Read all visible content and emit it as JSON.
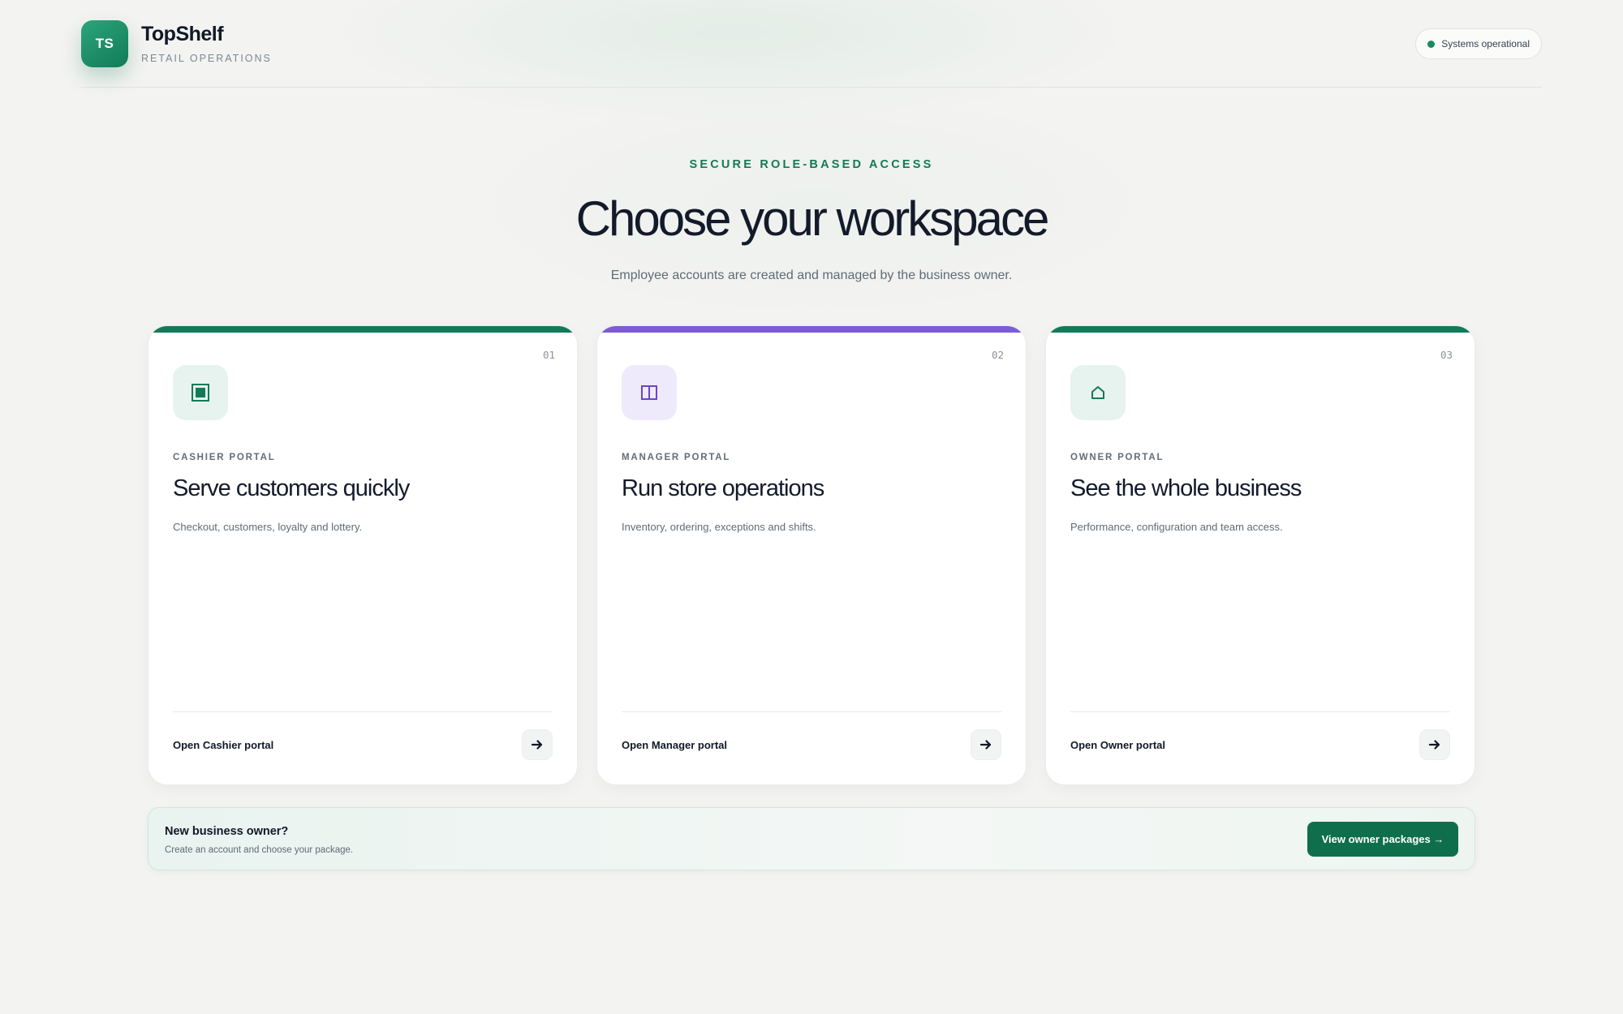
{
  "brand": {
    "logo_initials": "TS",
    "name": "TopShelf",
    "subtitle": "RETAIL OPERATIONS"
  },
  "status": {
    "label": "Systems operational",
    "color": "#1a8a62"
  },
  "hero": {
    "eyebrow": "SECURE ROLE-BASED ACCESS",
    "title": "Choose your workspace",
    "subtitle": "Employee accounts are created and managed by the business owner."
  },
  "cards": [
    {
      "number": "01",
      "icon": "register-icon",
      "icon_glyph": "▣",
      "accent": "#137a58",
      "icon_bg": "#e7f3ee",
      "role": "CASHIER PORTAL",
      "title": "Serve customers quickly",
      "description": "Checkout, customers, loyalty and lottery.",
      "open_label": "Open Cashier portal"
    },
    {
      "number": "02",
      "icon": "columns-icon",
      "icon_glyph": "◫",
      "accent": "#7c5cd6",
      "icon_bg": "#efeafb",
      "role": "MANAGER PORTAL",
      "title": "Run store operations",
      "description": "Inventory, ordering, exceptions and shifts.",
      "open_label": "Open Manager portal"
    },
    {
      "number": "03",
      "icon": "home-icon",
      "icon_glyph": "⌂",
      "accent": "#137a58",
      "icon_bg": "#e7f3ee",
      "role": "OWNER PORTAL",
      "title": "See the whole business",
      "description": "Performance, configuration and team access.",
      "open_label": "Open Owner portal"
    }
  ],
  "owner_banner": {
    "title": "New business owner?",
    "subtitle": "Create an account and choose your package.",
    "button_label": "View owner packages →"
  },
  "colors": {
    "primary": "#0f6f4c",
    "accent_purple": "#7c5cd6",
    "background": "#f3f3f1"
  }
}
